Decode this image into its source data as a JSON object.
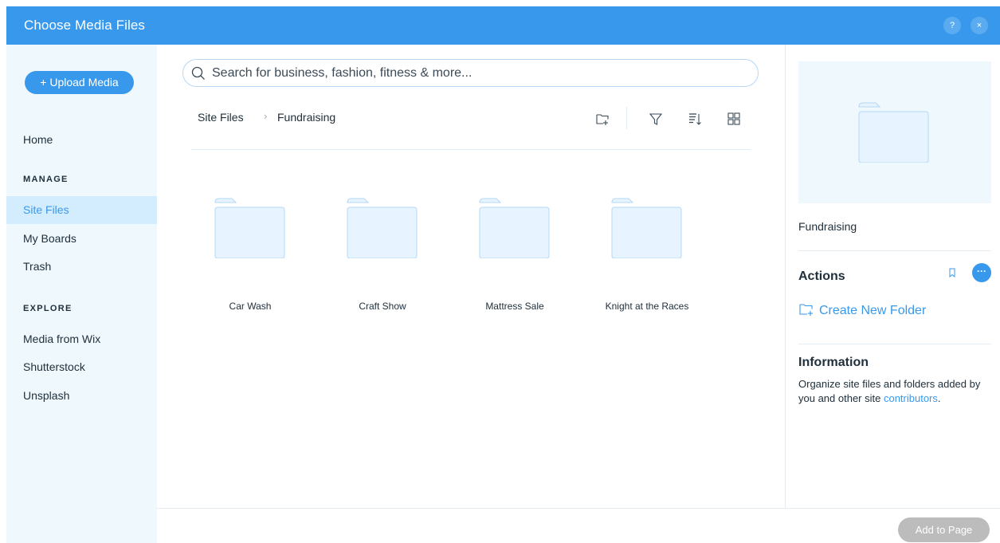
{
  "window": {
    "title": "Choose Media Files",
    "help_label": "?",
    "close_label": "×"
  },
  "sidebar": {
    "upload_label": "+ Upload Media",
    "home_label": "Home",
    "manage_header": "MANAGE",
    "manage_items": [
      {
        "label": "Site Files",
        "active": true
      },
      {
        "label": "My Boards",
        "active": false
      },
      {
        "label": "Trash",
        "active": false
      }
    ],
    "explore_header": "EXPLORE",
    "explore_items": [
      {
        "label": "Media from Wix"
      },
      {
        "label": "Shutterstock"
      },
      {
        "label": "Unsplash"
      }
    ]
  },
  "search": {
    "placeholder": "Search for business, fashion, fitness & more..."
  },
  "breadcrumb": {
    "root": "Site Files",
    "separator": "›",
    "current": "Fundraising"
  },
  "toolbar": {
    "icons": [
      "new-folder-icon",
      "filter-icon",
      "sort-icon",
      "grid-view-icon"
    ]
  },
  "folders": [
    {
      "name": "Car Wash"
    },
    {
      "name": "Craft Show"
    },
    {
      "name": "Mattress Sale"
    },
    {
      "name": "Knight at the Races"
    }
  ],
  "details": {
    "selected_name": "Fundraising",
    "actions_title": "Actions",
    "more_label": "···",
    "create_folder_label": "Create New Folder",
    "info_title": "Information",
    "info_text": "Organize site files and folders added by you and other site ",
    "info_link": "contributors",
    "info_end": "."
  },
  "footer": {
    "add_label": "Add to Page"
  },
  "colors": {
    "accent": "#3899ec",
    "sidebar_bg": "#eff8fc",
    "active_bg": "#d3edff",
    "folder_fill": "#e7f3fe",
    "folder_stroke": "#b6d8f5",
    "disabled_button": "#bcbcbc"
  }
}
